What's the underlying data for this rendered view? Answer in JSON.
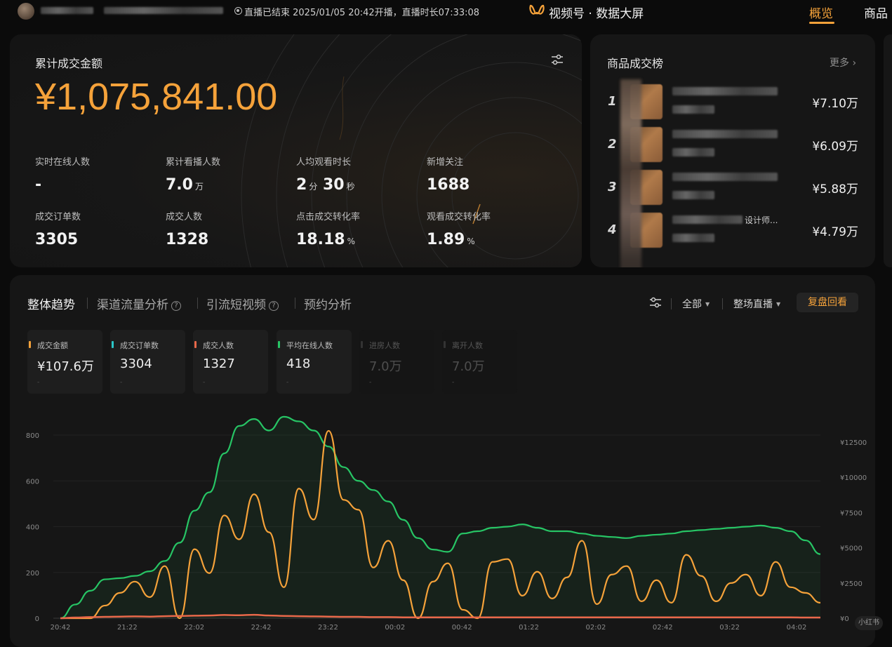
{
  "topbar": {
    "live_status": "直播已结束 2025/01/05 20:42开播，直播时长07:33:08",
    "brand_title": "视频号 · 数据大屏",
    "nav": [
      {
        "label": "概览"
      },
      {
        "label": "商品"
      }
    ]
  },
  "summary": {
    "gmv_label": "累计成交金额",
    "gmv_value": "¥1,075,841.00",
    "metrics": [
      {
        "label": "实时在线人数",
        "value": "-",
        "unit": ""
      },
      {
        "label": "累计看播人数",
        "value": "7.0",
        "unit": "万"
      },
      {
        "label": "人均观看时长",
        "value": "2",
        "unit": "分",
        "value2": "30",
        "unit2": "秒"
      },
      {
        "label": "新增关注",
        "value": "1688",
        "unit": ""
      },
      {
        "label": "成交订单数",
        "value": "3305",
        "unit": ""
      },
      {
        "label": "成交人数",
        "value": "1328",
        "unit": ""
      },
      {
        "label": "点击成交转化率",
        "value": "18.18",
        "unit": "%"
      },
      {
        "label": "观看成交转化率",
        "value": "1.89",
        "unit": "%"
      }
    ]
  },
  "ranking": {
    "title": "商品成交榜",
    "more_label": "更多 ›",
    "items": [
      {
        "rank": "1",
        "name_tail": "",
        "amount": "¥7.10万"
      },
      {
        "rank": "2",
        "name_tail": "",
        "amount": "¥6.09万"
      },
      {
        "rank": "3",
        "name_tail": "",
        "amount": "¥5.88万"
      },
      {
        "rank": "4",
        "name_tail": "设计师...",
        "amount": "¥4.79万"
      }
    ]
  },
  "trend": {
    "tabs": [
      {
        "label": "整体趋势",
        "help": false
      },
      {
        "label": "渠道流量分析",
        "help": true
      },
      {
        "label": "引流短视频",
        "help": true
      },
      {
        "label": "预约分析",
        "help": false
      }
    ],
    "help_glyph": "?",
    "dropdown_all": "全部",
    "dropdown_live": "整场直播",
    "caret_glyph": "▼",
    "review_button": "复盘回看",
    "kpis": [
      {
        "label": "成交金额",
        "value": "¥107.6万",
        "color": "#f5a23a",
        "active": true
      },
      {
        "label": "成交订单数",
        "value": "3304",
        "color": "#2bc7c9",
        "active": true
      },
      {
        "label": "成交人数",
        "value": "1327",
        "color": "#e8684a",
        "active": true
      },
      {
        "label": "平均在线人数",
        "value": "418",
        "color": "#27c565",
        "active": true
      },
      {
        "label": "进房人数",
        "value": "7.0万",
        "color": "#3a3a3a",
        "active": false
      },
      {
        "label": "离开人数",
        "value": "7.0万",
        "color": "#3a3a3a",
        "active": false
      }
    ],
    "kpi_dash": "-"
  },
  "chart_data": {
    "type": "line",
    "x_ticks": [
      "20:42",
      "21:22",
      "22:02",
      "22:42",
      "23:22",
      "00:02",
      "00:42",
      "01:22",
      "02:02",
      "02:42",
      "03:22",
      "04:02"
    ],
    "y_left_ticks": [
      "0",
      "200",
      "400",
      "600",
      "800"
    ],
    "y_right_ticks": [
      "¥0",
      "¥2500",
      "¥5000",
      "¥7500",
      "¥10000",
      "¥12500"
    ],
    "y_left_range": [
      0,
      800
    ],
    "y_right_range": [
      0,
      12500
    ],
    "grid": true,
    "series": [
      {
        "key": "online",
        "color": "#27c565",
        "axis": "left",
        "values": [
          0,
          60,
          120,
          170,
          175,
          185,
          205,
          250,
          330,
          470,
          550,
          720,
          840,
          870,
          820,
          880,
          860,
          820,
          750,
          660,
          600,
          560,
          510,
          430,
          350,
          300,
          290,
          370,
          380,
          395,
          400,
          410,
          395,
          380,
          380,
          370,
          360,
          355,
          350,
          360,
          365,
          370,
          380,
          385,
          390,
          395,
          400,
          405,
          395,
          380,
          340,
          280
        ]
      },
      {
        "key": "gmv",
        "color": "#f5a23a",
        "axis": "right",
        "values": [
          0,
          0,
          0,
          900,
          1800,
          2600,
          1500,
          3700,
          0,
          4900,
          3200,
          7300,
          5600,
          8800,
          6100,
          2200,
          9200,
          7000,
          13300,
          8400,
          7700,
          3600,
          5500,
          2700,
          0,
          2600,
          3900,
          600,
          0,
          4000,
          4200,
          1600,
          3300,
          1400,
          2900,
          5500,
          1000,
          3100,
          3700,
          1200,
          2700,
          1100,
          4500,
          3000,
          1200,
          2500,
          3100,
          1600,
          4000,
          2200,
          1800,
          1100
        ]
      },
      {
        "key": "buyers",
        "color": "#e8684a",
        "axis": "left",
        "values": [
          0,
          3,
          5,
          6,
          7,
          8,
          7,
          9,
          10,
          11,
          12,
          14,
          13,
          15,
          12,
          10,
          9,
          8,
          7,
          6,
          6,
          5,
          5,
          4,
          4,
          4,
          4,
          4,
          4,
          4,
          4,
          4,
          4,
          4,
          4,
          4,
          4,
          4,
          4,
          4,
          4,
          4,
          4,
          4,
          4,
          4,
          4,
          4,
          4,
          4,
          3,
          3
        ]
      }
    ]
  }
}
